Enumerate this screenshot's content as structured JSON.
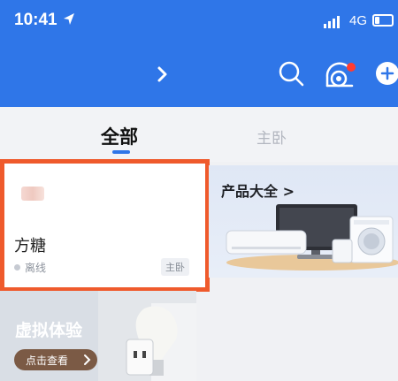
{
  "status_bar": {
    "time": "10:41",
    "network": "4G"
  },
  "tabs": [
    {
      "label": "全部",
      "active": true
    },
    {
      "label": "主卧",
      "active": false
    }
  ],
  "device_card": {
    "name": "方糖",
    "status": "离线",
    "room": "主卧"
  },
  "products": {
    "title": "产品大全 >"
  },
  "virtual": {
    "title": "虚拟体验",
    "button": "点击查看"
  },
  "colors": {
    "header": "#2f76e8",
    "highlight_border": "#ef5a2c",
    "active_tab_underline": "#2f76e8"
  },
  "icons": [
    "location-arrow-icon",
    "signal-icon",
    "battery-icon",
    "chevron-right-icon",
    "search-icon",
    "device-icon",
    "add-icon",
    "offline-dot-icon"
  ]
}
